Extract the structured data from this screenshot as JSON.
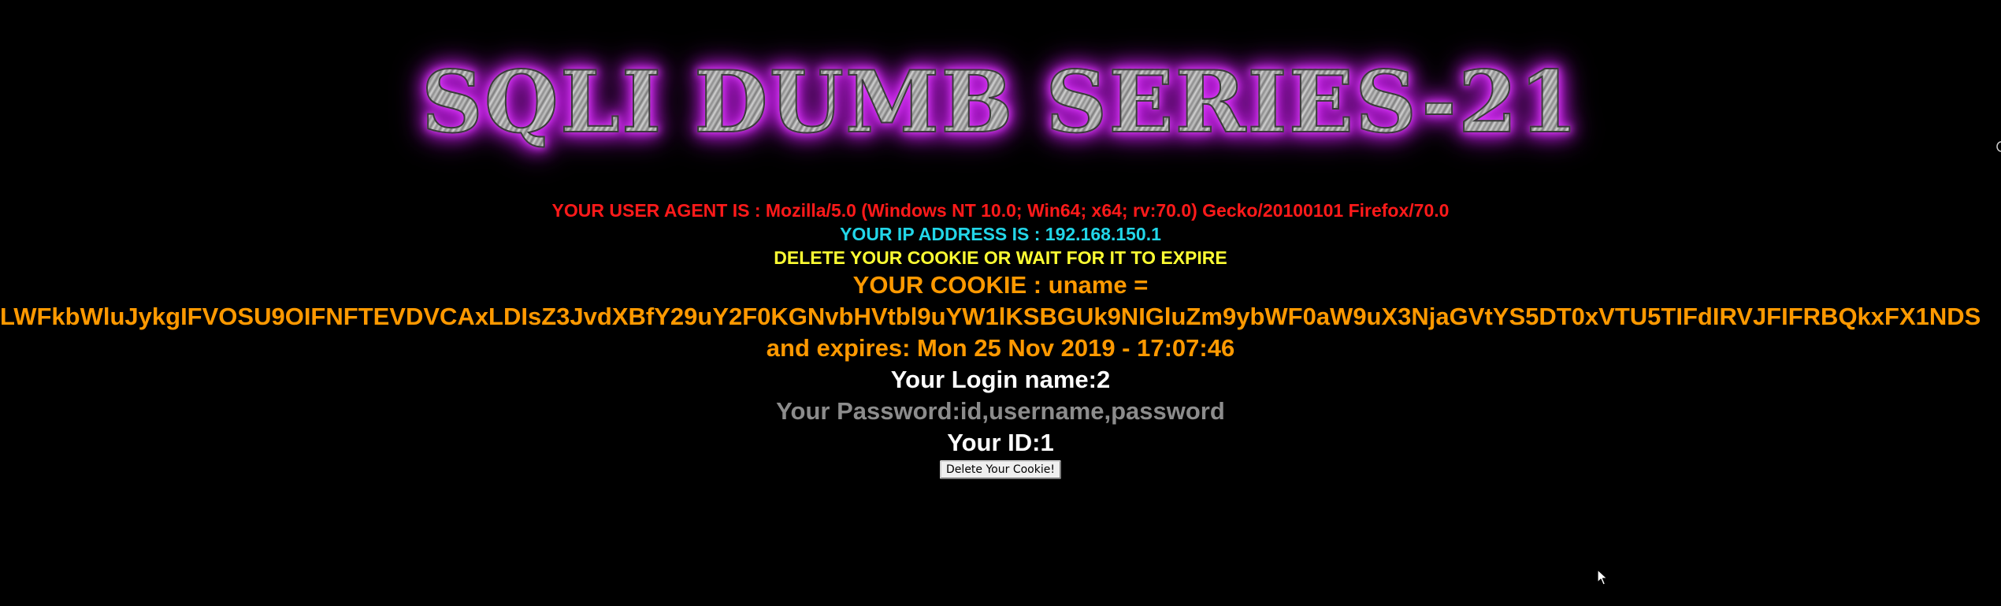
{
  "header": {
    "title": "SQLI DUMB SERIES-21"
  },
  "info": {
    "user_agent": "YOUR USER AGENT IS : Mozilla/5.0 (Windows NT 10.0; Win64; x64; rv:70.0) Gecko/20100101 Firefox/70.0",
    "ip_address": "YOUR IP ADDRESS IS : 192.168.150.1",
    "delete_notice": "DELETE YOUR COOKIE OR WAIT FOR IT TO EXPIRE",
    "cookie_label": "YOUR COOKIE : uname =",
    "cookie_value": "LWFkbWluJykgIFVOSU9OIFNFTEVDVCAxLDIsZ3JvdXBfY29uY2F0KGNvbHVtbl9uYW1lKSBGUk9NIGluZm9ybWF0aW9uX3NjaGVtYS5DT0xVTU5TIFdIRVJFIFRBQkxFX1NDS",
    "expires": "and expires: Mon 25 Nov 2019 - 17:07:46",
    "login_name": "Your Login name:2",
    "password": "Your Password:id,username,password",
    "id": "Your ID:1"
  },
  "actions": {
    "delete_button_label": "Delete Your Cookie!"
  },
  "colors": {
    "user_agent": "#ff1a1a",
    "ip_address": "#22d6e8",
    "delete_notice": "#ffff33",
    "cookie": "#ff9900",
    "login_name": "#ffffff",
    "password": "#8c8c8c",
    "id": "#ffffff",
    "banner_glow": "#d020f0"
  },
  "icons": {
    "cursor": "mouse-pointer-icon"
  }
}
